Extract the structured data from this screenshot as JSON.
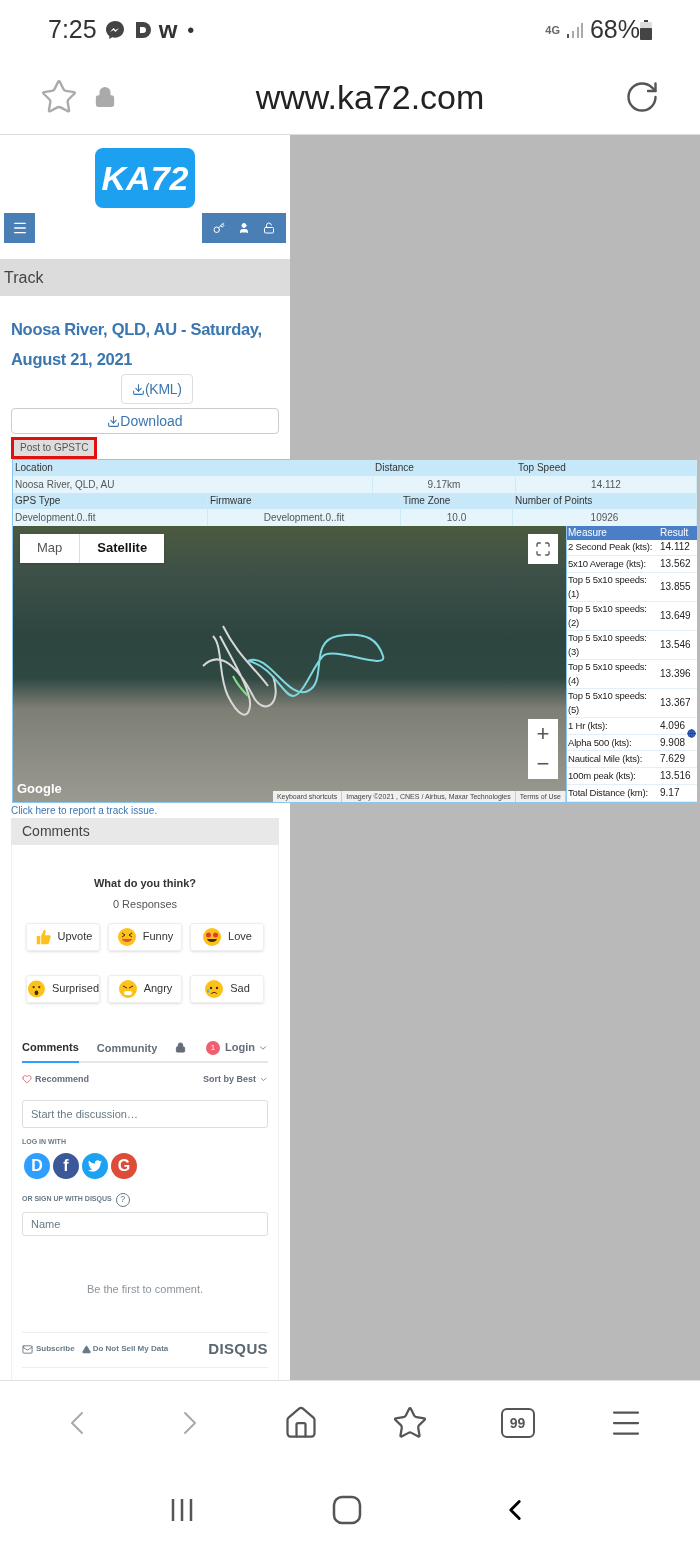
{
  "status_bar": {
    "time": "7:25",
    "app_letter": "w",
    "dot": "•",
    "network": "4G",
    "battery": "68%"
  },
  "browser": {
    "url": "www.ka72.com"
  },
  "site": {
    "logo": "KA72",
    "section_title": "Track"
  },
  "track": {
    "title": "Noosa River, QLD, AU - Saturday, August 21, 2021",
    "kml_button": "(KML)",
    "download_button": "Download",
    "post_button": "Post to GPSTC",
    "info_rows": [
      {
        "cells": [
          {
            "label": "Location",
            "value": "Noosa River, QLD, AU"
          },
          {
            "label": "Distance",
            "value": "9.17km"
          },
          {
            "label": "Top Speed",
            "value": "14.112"
          }
        ]
      },
      {
        "cells": [
          {
            "label": "GPS Type",
            "value": "Development.0..fit"
          },
          {
            "label": "Firmware",
            "value": "Development.0..fit"
          },
          {
            "label": "Time Zone",
            "value": "10.0"
          },
          {
            "label": "Number of Points",
            "value": "10926"
          }
        ]
      }
    ],
    "map": {
      "map_types": [
        {
          "label": "Map",
          "selected": false
        },
        {
          "label": "Satellite",
          "selected": true
        }
      ],
      "zoom_in": "+",
      "zoom_out": "−",
      "google": "Google",
      "attribution": [
        "Keyboard shortcuts",
        "Imagery ©2021 , CNES / Airbus, Maxar Technologies",
        "Terms of Use"
      ]
    },
    "measures": {
      "columns": [
        "Measure",
        "Result"
      ],
      "rows": [
        {
          "measure": "2 Second Peak (kts):",
          "result": "14.112"
        },
        {
          "measure": "5x10 Average (kts):",
          "result": "13.562"
        },
        {
          "measure": "Top 5 5x10 speeds: (1)",
          "result": "13.855"
        },
        {
          "measure": "Top 5 5x10 speeds: (2)",
          "result": "13.649"
        },
        {
          "measure": "Top 5 5x10 speeds: (3)",
          "result": "13.546"
        },
        {
          "measure": "Top 5 5x10 speeds: (4)",
          "result": "13.396"
        },
        {
          "measure": "Top 5 5x10 speeds: (5)",
          "result": "13.367"
        },
        {
          "measure": "1 Hr (kts):",
          "result": "4.096"
        },
        {
          "measure": "Alpha 500 (kts):",
          "result": "9.908"
        },
        {
          "measure": "Nautical Mile (kts):",
          "result": "7.629"
        },
        {
          "measure": "100m peak (kts):",
          "result": "13.516"
        },
        {
          "measure": "Total Distance (km):",
          "result": "9.17"
        }
      ]
    },
    "report_link": "Click here to report a track issue."
  },
  "comments": {
    "heading": "Comments",
    "prompt": "What do you think?",
    "responses": "0 Responses",
    "reactions": [
      {
        "kind": "thumbs",
        "label": "Upvote"
      },
      {
        "kind": "laugh",
        "label": "Funny"
      },
      {
        "kind": "hearts",
        "label": "Love"
      },
      {
        "kind": "wow",
        "label": "Surprised"
      },
      {
        "kind": "angry",
        "label": "Angry"
      },
      {
        "kind": "sad",
        "label": "Sad"
      }
    ],
    "tabs": [
      {
        "label": "Comments",
        "selected": true
      },
      {
        "label": "Community",
        "selected": false
      }
    ],
    "login_badge": "1",
    "login": "Login",
    "recommend": "Recommend",
    "sort": "Sort by Best",
    "discussion_placeholder": "Start the discussion…",
    "log_in_with": "LOG IN WITH",
    "social": [
      {
        "kind": "letter",
        "label": "D",
        "color": "#2e9fff"
      },
      {
        "kind": "letter",
        "label": "f",
        "color": "#3b5998"
      },
      {
        "kind": "bird",
        "color": "#1da1f2"
      },
      {
        "kind": "letter",
        "label": "G",
        "color": "#dd4b39"
      }
    ],
    "sign_up": "OR SIGN UP WITH DISQUS",
    "help": "?",
    "name_placeholder": "Name",
    "empty": "Be the first to comment.",
    "subscribe": "Subscribe",
    "do_not_sell": "Do Not Sell My Data",
    "brand": "DISQUS"
  },
  "toolbar": {
    "tabs_count": "99"
  }
}
